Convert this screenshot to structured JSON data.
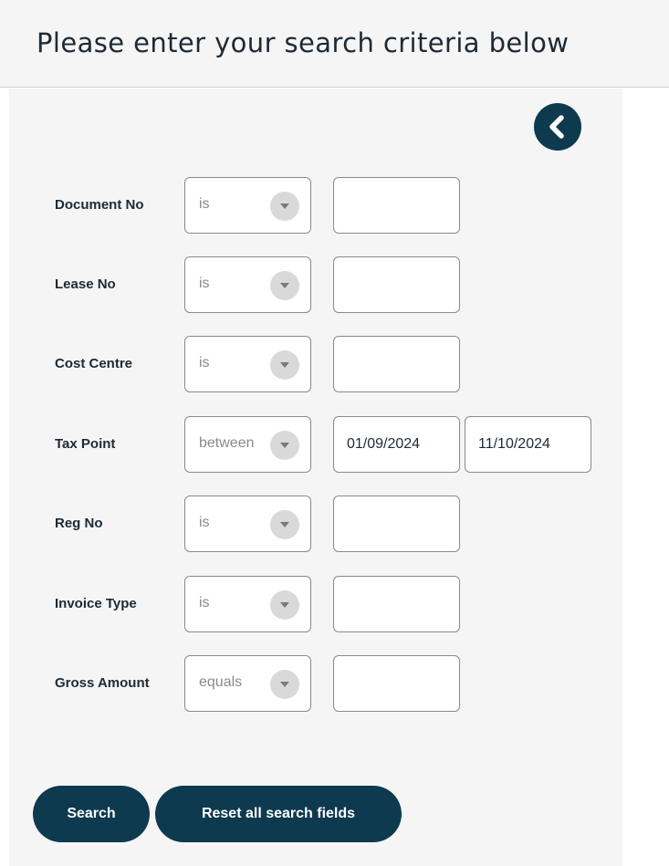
{
  "header": {
    "title": "Please enter your search criteria below"
  },
  "back_button": {
    "icon": "chevron-left-icon"
  },
  "criteria": [
    {
      "label": "Document No",
      "operator": "is",
      "value": ""
    },
    {
      "label": "Lease No",
      "operator": "is",
      "value": ""
    },
    {
      "label": "Cost Centre",
      "operator": "is",
      "value": ""
    },
    {
      "label": "Tax Point",
      "operator": "between",
      "value": "01/09/2024",
      "value2": "11/10/2024"
    },
    {
      "label": "Reg No",
      "operator": "is",
      "value": ""
    },
    {
      "label": "Invoice Type",
      "operator": "is",
      "value": ""
    },
    {
      "label": "Gross Amount",
      "operator": "equals",
      "value": ""
    }
  ],
  "actions": {
    "search_label": "Search",
    "reset_label": "Reset all search fields"
  },
  "colors": {
    "accent": "#0d3a4f",
    "panel_bg": "#f5f5f5",
    "border": "#8a8a8a",
    "placeholder_text": "#8a8a8a"
  }
}
